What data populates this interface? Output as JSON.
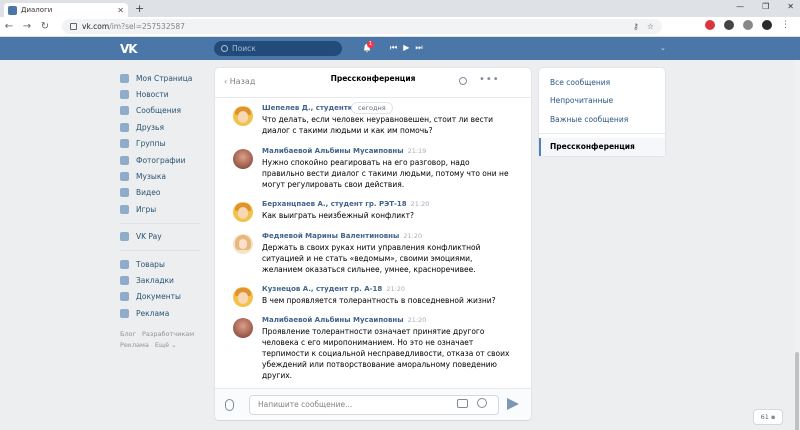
{
  "browser": {
    "tab_title": "Диалоги",
    "url_host": "vk.com",
    "url_path": "/im?sel=257532587"
  },
  "vk": {
    "logo": "VK",
    "search_placeholder": "Поиск",
    "notification_count": "1"
  },
  "sidebar": {
    "items": [
      {
        "label": "Моя Страница",
        "icon": "home-icon"
      },
      {
        "label": "Новости",
        "icon": "news-icon"
      },
      {
        "label": "Сообщения",
        "icon": "messages-icon"
      },
      {
        "label": "Друзья",
        "icon": "friends-icon"
      },
      {
        "label": "Группы",
        "icon": "groups-icon"
      },
      {
        "label": "Фотографии",
        "icon": "photos-icon"
      },
      {
        "label": "Музыка",
        "icon": "music-icon"
      },
      {
        "label": "Видео",
        "icon": "video-icon"
      },
      {
        "label": "Игры",
        "icon": "games-icon"
      },
      {
        "label": "VK Pay",
        "icon": "vkpay-icon"
      },
      {
        "label": "Товары",
        "icon": "goods-icon"
      },
      {
        "label": "Закладки",
        "icon": "bookmarks-icon"
      },
      {
        "label": "Документы",
        "icon": "documents-icon"
      },
      {
        "label": "Реклама",
        "icon": "ads-icon"
      }
    ],
    "footer": [
      "Блог",
      "Разработчикам",
      "Реклама",
      "Ещё ⌄"
    ]
  },
  "chat": {
    "back_label": "Назад",
    "title": "Прессконференция",
    "today_label": "сегодня",
    "input_placeholder": "Напишите сообщение...",
    "messages": [
      {
        "author": "Шепелев Д., студентка гр.",
        "time": "",
        "text": "Что делать, если человек неуравновешен, стоит ли вести\nдиалог с такими людьми и как им помочь?"
      },
      {
        "author": "Малибаевой Альбины Мусаиповны",
        "time": "21:19",
        "text": "Нужно спокойно реагировать на его разговор, надо\nправильно вести диалог с такими людьми, потому что они не\nмогут регулировать свои действия."
      },
      {
        "author": "Берханцпаев А., студент гр. РЭТ-18",
        "time": "21:20",
        "text": "Как выиграть неизбежный конфликт?"
      },
      {
        "author": "Федяевой Марины Валентиновны",
        "time": "21:20",
        "text": "Держать в своих руках нити управления конфликтной\nситуацией и не стать «ведомым», своими эмоциями,\nжеланием оказаться сильнее, умнее, красноречивее."
      },
      {
        "author": "Кузнецов А., студент гр. А-18",
        "time": "21:20",
        "text": "В чем проявляется толерантность в повседневной жизни?"
      },
      {
        "author": "Малибаевой Альбины Мусаиповны",
        "time": "21:20",
        "text": "Проявление толерантности означает принятие другого\nчеловека с его миропониманием. Но это не означает\nтерпимости к социальной несправедливости, отказа от своих\nубеждений или потворствование аморальному поведению\nдругих."
      }
    ]
  },
  "folders": {
    "items": [
      "Все сообщения",
      "Непрочитанные",
      "Важные сообщения"
    ],
    "active": "Прессконференция"
  },
  "counter": "61"
}
